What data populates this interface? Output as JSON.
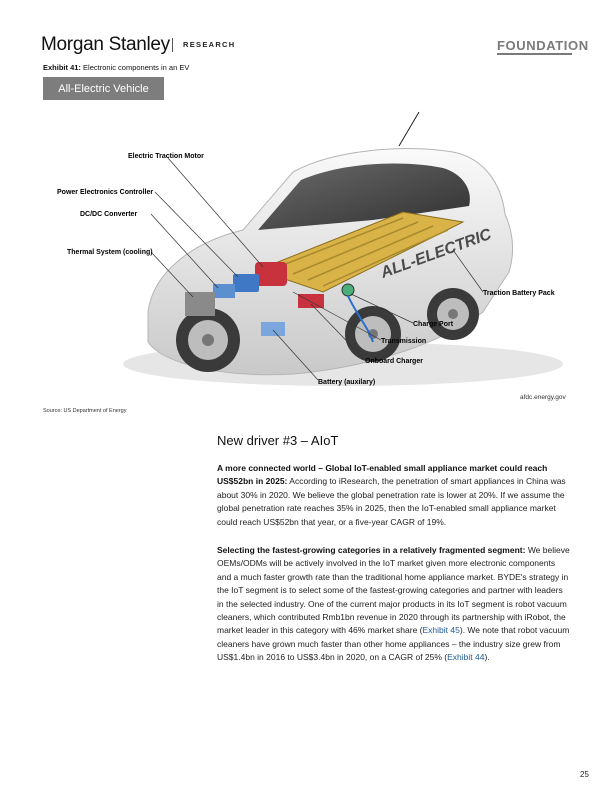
{
  "header": {
    "logo": "Morgan Stanley",
    "section": "RESEARCH",
    "brand_right": "FOUNDATION"
  },
  "exhibit": {
    "number": "Exhibit 41:",
    "title": "Electronic components in an EV",
    "figure_label": "All-Electric Vehicle",
    "car_side_text": "ALL-ELECTRIC",
    "callouts": {
      "electric_traction_motor": "Electric Traction Motor",
      "power_electronics_controller": "Power Electronics Controller",
      "dc_dc_converter": "DC/DC Converter",
      "thermal_system": "Thermal System (cooling)",
      "traction_battery_pack": "Traction Battery Pack",
      "charge_port": "Charge Port",
      "transmission": "Transmission",
      "onboard_charger": "Onboard Charger",
      "battery_auxiliary": "Battery (auxilary)"
    },
    "credit": "afdc.energy.gov",
    "source": "Source: US Department of Energy"
  },
  "section": {
    "heading": "New driver #3 – AIoT",
    "p1_bold": "A more connected world – Global IoT-enabled small appliance market could reach US$52bn in 2025:",
    "p1_text": " According to iResearch, the penetration of smart appliances in China was about 30% in 2020. We believe the global penetration rate is lower at 20%. If we assume the global penetration rate reaches 35% in 2025, then the IoT-enabled small appliance market could reach US$52bn that year, or a five-year CAGR of 19%.",
    "p2_bold": "Selecting the fastest-growing categories in a relatively fragmented segment:",
    "p2_text_a": " We believe OEMs/ODMs will be actively involved in the IoT market given more electronic components and a much faster growth rate than the traditional home appliance market. BYDE's strategy in the IoT segment is to select some of the fastest-growing categories and partner with leaders in the selected industry. One of the current major products in its IoT segment is robot vacuum cleaners, which contributed Rmb1bn revenue in 2020 through its partnership with iRobot, the market leader in this category with 46% market share (",
    "p2_link_a": "Exhibit 45",
    "p2_text_b": "). We note that robot vacuum cleaners have grown much faster than other home appliances – the industry size grew from US$1.4bn in 2016 to US$3.4bn in 2020, on a CAGR of 25% (",
    "p2_link_b": "Exhibit 44",
    "p2_text_c": ")."
  },
  "footer": {
    "page_number": "25"
  }
}
